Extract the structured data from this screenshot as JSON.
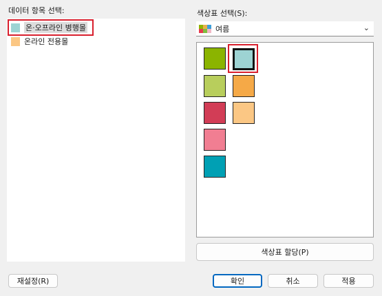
{
  "left_panel": {
    "title": "데이터 항목 선택:",
    "items": [
      {
        "label": "온·오프라인 병행몰",
        "color": "#9dd3d3",
        "selected": true
      },
      {
        "label": "온라인 전용몰",
        "color": "#fbc784",
        "selected": false
      }
    ]
  },
  "right_panel": {
    "title": "색상표 선택(S):",
    "palette_value": "여름",
    "palette_icon_colors": [
      "#8fb300",
      "#e8b04c",
      "#3d9fd9",
      "#e83a4f",
      "#7fbf3f",
      "#f2b8c6"
    ],
    "swatches": [
      {
        "color": "#8bb400",
        "selected": false
      },
      {
        "color": "#9dd3d3",
        "selected": true
      },
      {
        "color": "#b8ce5c",
        "selected": false
      },
      {
        "color": "#f5a947",
        "selected": false
      },
      {
        "color": "#d23d56",
        "selected": false
      },
      {
        "color": "#fbc784",
        "selected": false
      },
      {
        "color": "#f17e92",
        "selected": false
      },
      {
        "color": "#00a0b4",
        "selected": false
      }
    ],
    "assign_button": "색상표 할당(P)"
  },
  "footer": {
    "reset": "재설정(R)",
    "ok": "확인",
    "cancel": "취소",
    "apply": "적용"
  },
  "colors": {
    "highlight": "#d81e2c",
    "primary_border": "#0067c0"
  }
}
